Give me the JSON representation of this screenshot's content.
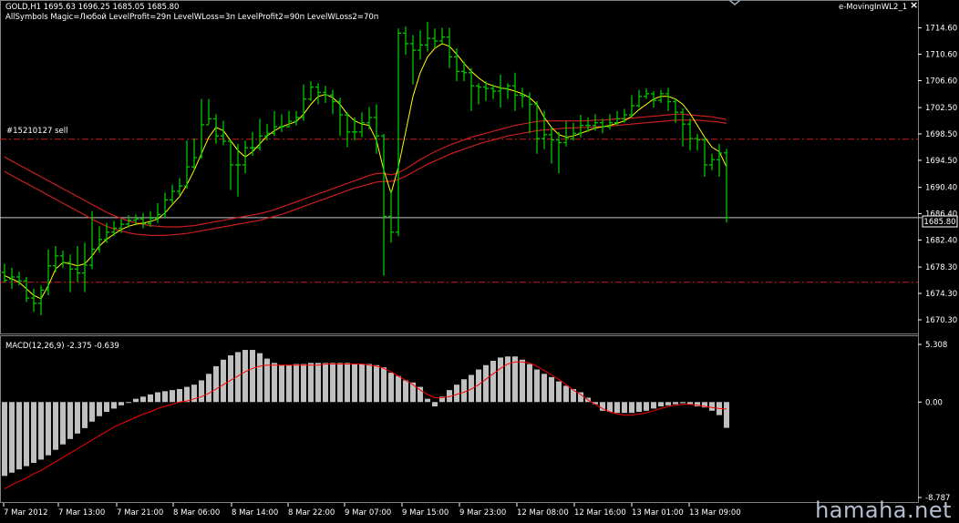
{
  "header": {
    "line1": "GOLD,H1  1695.63 1696.25 1685.05 1685.80",
    "line2": "AllSymbols  Magic=Любой  LevelProfit=29п  LevelWLoss=3п  LevelProfit2=90п  LevelWLoss2=70п",
    "indicator_name": "e-MovingInWL2_1",
    "close_glyph": "×"
  },
  "order_label": "#15210127 sell",
  "price_tag": "1685.80",
  "macd_label": "MACD(12,26,9) -2.375 -0.639",
  "watermark": "hamaha.net",
  "colors": {
    "bg": "#000000",
    "bull": "#00c800",
    "ma_yellow": "#ffff00",
    "ma_red": "#c81e1e",
    "order_line": "#c81e1e",
    "histogram": "#c0c0c0",
    "signal": "#ff0000",
    "grid": "#ffffff"
  },
  "chart_data": [
    {
      "type": "candlestick",
      "title": "GOLD,H1",
      "y_ticks": [
        "1714.60",
        "1710.60",
        "1706.60",
        "1702.50",
        "1698.50",
        "1694.50",
        "1690.40",
        "1686.40",
        "1682.40",
        "1678.30",
        "1674.30",
        "1670.30"
      ],
      "x_ticks": [
        "7 Mar 2012",
        "7 Mar 13:00",
        "7 Mar 21:00",
        "8 Mar 06:00",
        "8 Mar 14:00",
        "8 Mar 22:00",
        "9 Mar 07:00",
        "9 Mar 15:00",
        "9 Mar 23:00",
        "12 Mar 08:00",
        "12 Mar 16:00",
        "13 Mar 01:00",
        "13 Mar 09:00"
      ],
      "ylim": [
        1668.5,
        1716.2
      ],
      "levels": {
        "current_price": 1685.8,
        "order_sell": 1697.7,
        "level_low": 1676.0
      },
      "last_bar": {
        "open": 1695.63,
        "high": 1696.25,
        "low": 1685.05,
        "close": 1685.8
      },
      "bars": [
        [
          1677.5,
          1676.3,
          1678.8,
          1676.0
        ],
        [
          1676.5,
          1676.8,
          1678.2,
          1675.0
        ],
        [
          1676.8,
          1676.2,
          1677.6,
          1675.5
        ],
        [
          1676.2,
          1673.6,
          1676.8,
          1673.0
        ],
        [
          1673.6,
          1672.8,
          1675.0,
          1671.5
        ],
        [
          1672.8,
          1674.8,
          1675.5,
          1671.0
        ],
        [
          1674.8,
          1678.5,
          1681.0,
          1674.0
        ],
        [
          1678.5,
          1680.0,
          1681.5,
          1677.5
        ],
        [
          1680.0,
          1679.0,
          1680.8,
          1678.2
        ],
        [
          1679.0,
          1678.0,
          1680.2,
          1674.5
        ],
        [
          1678.0,
          1677.4,
          1681.5,
          1676.0
        ],
        [
          1677.4,
          1678.6,
          1682.0,
          1674.5
        ],
        [
          1678.6,
          1681.0,
          1686.8,
          1678.0
        ],
        [
          1681.0,
          1682.5,
          1684.5,
          1680.5
        ],
        [
          1682.5,
          1683.6,
          1685.0,
          1682.0
        ],
        [
          1683.6,
          1684.2,
          1685.3,
          1683.0
        ],
        [
          1684.2,
          1684.8,
          1685.6,
          1683.5
        ],
        [
          1684.8,
          1685.4,
          1686.2,
          1684.3
        ],
        [
          1685.4,
          1685.6,
          1686.3,
          1684.8
        ],
        [
          1685.6,
          1684.9,
          1686.5,
          1684.2
        ],
        [
          1684.9,
          1685.7,
          1686.8,
          1684.4
        ],
        [
          1685.7,
          1686.3,
          1688.0,
          1685.0
        ],
        [
          1686.3,
          1688.5,
          1689.6,
          1685.8
        ],
        [
          1688.5,
          1689.8,
          1690.8,
          1688.0
        ],
        [
          1689.8,
          1690.6,
          1691.8,
          1689.2
        ],
        [
          1690.6,
          1693.5,
          1697.5,
          1690.2
        ],
        [
          1693.5,
          1694.9,
          1697.8,
          1693.0
        ],
        [
          1694.9,
          1699.9,
          1703.8,
          1694.8
        ],
        [
          1699.9,
          1700.8,
          1703.8,
          1700.0
        ],
        [
          1700.8,
          1698.2,
          1701.5,
          1697.0
        ],
        [
          1698.2,
          1697.4,
          1700.5,
          1696.8
        ],
        [
          1697.4,
          1693.8,
          1697.5,
          1690.0
        ],
        [
          1693.8,
          1693.8,
          1697.0,
          1689.0
        ],
        [
          1693.8,
          1696.4,
          1697.5,
          1692.5
        ],
        [
          1696.4,
          1696.4,
          1698.8,
          1695.2
        ],
        [
          1696.4,
          1698.2,
          1700.8,
          1696.0
        ],
        [
          1698.2,
          1698.6,
          1700.0,
          1697.5
        ],
        [
          1698.6,
          1699.6,
          1702.0,
          1698.2
        ],
        [
          1699.6,
          1699.6,
          1701.5,
          1698.8
        ],
        [
          1699.6,
          1700.4,
          1702.0,
          1699.5
        ],
        [
          1700.4,
          1701.0,
          1702.0,
          1699.8
        ],
        [
          1701.0,
          1703.8,
          1706.0,
          1700.5
        ],
        [
          1703.8,
          1705.6,
          1706.5,
          1703.5
        ],
        [
          1705.6,
          1704.8,
          1706.2,
          1703.0
        ],
        [
          1704.8,
          1704.4,
          1705.8,
          1703.2
        ],
        [
          1704.4,
          1703.4,
          1705.2,
          1701.5
        ],
        [
          1703.4,
          1701.4,
          1704.0,
          1698.2
        ],
        [
          1701.4,
          1698.8,
          1701.8,
          1696.5
        ],
        [
          1698.8,
          1698.8,
          1701.0,
          1697.5
        ],
        [
          1698.8,
          1700.2,
          1701.8,
          1698.0
        ],
        [
          1700.2,
          1701.0,
          1702.6,
          1699.2
        ],
        [
          1701.0,
          1698.2,
          1703.0,
          1695.5
        ],
        [
          1698.2,
          1686.0,
          1698.5,
          1677.0
        ],
        [
          1686.0,
          1683.6,
          1690.0,
          1682.0
        ],
        [
          1683.6,
          1713.8,
          1714.5,
          1683.0
        ],
        [
          1713.8,
          1712.2,
          1714.8,
          1710.5
        ],
        [
          1712.2,
          1711.2,
          1713.5,
          1706.0
        ],
        [
          1711.2,
          1712.0,
          1714.2,
          1709.8
        ],
        [
          1712.0,
          1713.0,
          1715.5,
          1711.0
        ],
        [
          1713.0,
          1712.6,
          1714.5,
          1711.5
        ],
        [
          1712.6,
          1713.2,
          1714.6,
          1712.2
        ],
        [
          1713.2,
          1710.2,
          1714.6,
          1708.5
        ],
        [
          1710.2,
          1708.0,
          1711.5,
          1706.5
        ],
        [
          1708.0,
          1707.8,
          1709.5,
          1706.5
        ],
        [
          1707.8,
          1705.8,
          1708.5,
          1702.0
        ],
        [
          1705.8,
          1705.6,
          1706.2,
          1703.0
        ],
        [
          1705.6,
          1705.4,
          1706.5,
          1703.5
        ],
        [
          1705.4,
          1705.0,
          1706.0,
          1703.8
        ],
        [
          1705.0,
          1705.4,
          1707.5,
          1702.5
        ],
        [
          1705.4,
          1705.8,
          1706.2,
          1703.8
        ],
        [
          1705.8,
          1704.4,
          1707.8,
          1702.0
        ],
        [
          1704.4,
          1704.2,
          1705.5,
          1702.5
        ],
        [
          1704.2,
          1703.0,
          1704.8,
          1698.6
        ],
        [
          1703.0,
          1697.8,
          1703.5,
          1695.5
        ],
        [
          1697.8,
          1698.4,
          1702.0,
          1696.2
        ],
        [
          1698.4,
          1697.6,
          1699.5,
          1694.0
        ],
        [
          1697.6,
          1697.2,
          1698.8,
          1692.5
        ],
        [
          1697.2,
          1697.8,
          1700.4,
          1696.6
        ],
        [
          1697.8,
          1698.6,
          1700.2,
          1697.5
        ],
        [
          1698.6,
          1699.8,
          1701.4,
          1698.0
        ],
        [
          1699.8,
          1699.8,
          1701.0,
          1698.8
        ],
        [
          1699.8,
          1700.2,
          1701.5,
          1699.0
        ],
        [
          1700.2,
          1699.6,
          1700.8,
          1698.6
        ],
        [
          1699.6,
          1700.2,
          1701.5,
          1699.2
        ],
        [
          1700.2,
          1700.8,
          1702.0,
          1699.8
        ],
        [
          1700.8,
          1701.4,
          1702.3,
          1700.2
        ],
        [
          1701.4,
          1702.8,
          1704.4,
          1701.0
        ],
        [
          1702.8,
          1704.2,
          1705.2,
          1702.5
        ],
        [
          1704.2,
          1704.6,
          1705.4,
          1703.8
        ],
        [
          1704.6,
          1703.6,
          1705.0,
          1702.5
        ],
        [
          1703.6,
          1704.6,
          1705.2,
          1703.2
        ],
        [
          1704.6,
          1703.4,
          1705.5,
          1702.0
        ],
        [
          1703.4,
          1701.8,
          1703.8,
          1700.2
        ],
        [
          1701.8,
          1700.0,
          1702.4,
          1696.6
        ],
        [
          1700.0,
          1697.8,
          1700.8,
          1696.0
        ],
        [
          1697.8,
          1697.6,
          1698.5,
          1696.0
        ],
        [
          1697.6,
          1693.8,
          1698.0,
          1692.0
        ],
        [
          1693.8,
          1694.6,
          1695.5,
          1693.0
        ],
        [
          1694.6,
          1695.6,
          1697.0,
          1692.0
        ],
        [
          1695.63,
          1685.8,
          1696.25,
          1685.05
        ]
      ],
      "ma_yellow": [
        1677.0,
        1676.5,
        1676.0,
        1675.0,
        1674.0,
        1673.5,
        1675.5,
        1678.0,
        1679.0,
        1678.8,
        1678.5,
        1678.8,
        1680.0,
        1681.5,
        1682.5,
        1683.3,
        1684.0,
        1684.5,
        1684.8,
        1685.0,
        1685.2,
        1685.6,
        1686.5,
        1687.8,
        1689.0,
        1690.8,
        1693.0,
        1695.5,
        1698.0,
        1699.5,
        1699.0,
        1697.5,
        1696.0,
        1695.0,
        1695.8,
        1697.0,
        1698.2,
        1699.0,
        1699.6,
        1700.0,
        1700.4,
        1701.5,
        1703.0,
        1704.2,
        1704.5,
        1704.0,
        1703.0,
        1701.5,
        1700.5,
        1700.0,
        1699.8,
        1697.5,
        1693.0,
        1689.5,
        1693.5,
        1698.8,
        1704.2,
        1707.8,
        1710.2,
        1711.5,
        1712.2,
        1711.8,
        1710.6,
        1709.2,
        1708.0,
        1707.0,
        1706.2,
        1705.8,
        1705.5,
        1705.3,
        1705.0,
        1704.6,
        1704.0,
        1703.0,
        1701.0,
        1699.5,
        1698.4,
        1698.0,
        1698.2,
        1698.6,
        1699.0,
        1699.4,
        1699.6,
        1699.8,
        1700.1,
        1700.5,
        1701.2,
        1702.2,
        1703.0,
        1703.8,
        1704.2,
        1704.2,
        1703.8,
        1703.0,
        1701.6,
        1699.8,
        1698.0,
        1696.5,
        1695.8,
        1693.5
      ],
      "ma_red1": [
        1695.0,
        1694.4,
        1693.8,
        1693.2,
        1692.6,
        1692.0,
        1691.4,
        1690.8,
        1690.2,
        1689.6,
        1689.0,
        1688.4,
        1687.8,
        1687.2,
        1686.6,
        1686.1,
        1685.7,
        1685.3,
        1685.0,
        1684.8,
        1684.6,
        1684.5,
        1684.4,
        1684.4,
        1684.4,
        1684.5,
        1684.6,
        1684.8,
        1685.0,
        1685.2,
        1685.4,
        1685.6,
        1685.8,
        1686.0,
        1686.2,
        1686.4,
        1686.7,
        1687.0,
        1687.4,
        1687.8,
        1688.2,
        1688.6,
        1689.0,
        1689.4,
        1689.8,
        1690.2,
        1690.6,
        1691.0,
        1691.4,
        1691.8,
        1692.2,
        1692.5,
        1692.5,
        1692.3,
        1692.6,
        1693.2,
        1693.9,
        1694.6,
        1695.2,
        1695.8,
        1696.3,
        1696.8,
        1697.2,
        1697.6,
        1698.0,
        1698.3,
        1698.6,
        1698.9,
        1699.2,
        1699.5,
        1699.8,
        1700.0,
        1700.2,
        1700.4,
        1700.5,
        1700.5,
        1700.5,
        1700.5,
        1700.5,
        1700.5,
        1700.5,
        1700.6,
        1700.6,
        1700.7,
        1700.8,
        1700.8,
        1700.9,
        1701.0,
        1701.1,
        1701.2,
        1701.3,
        1701.4,
        1701.5,
        1701.5,
        1701.4,
        1701.3,
        1701.2,
        1701.1,
        1700.9,
        1700.7
      ],
      "ma_red2": [
        1692.8,
        1692.2,
        1691.6,
        1691.0,
        1690.4,
        1689.8,
        1689.2,
        1688.6,
        1688.0,
        1687.4,
        1686.8,
        1686.2,
        1685.6,
        1685.0,
        1684.5,
        1684.1,
        1683.8,
        1683.5,
        1683.3,
        1683.2,
        1683.1,
        1683.1,
        1683.1,
        1683.2,
        1683.3,
        1683.4,
        1683.6,
        1683.8,
        1684.0,
        1684.2,
        1684.4,
        1684.6,
        1684.8,
        1685.0,
        1685.2,
        1685.4,
        1685.7,
        1686.0,
        1686.3,
        1686.7,
        1687.1,
        1687.5,
        1687.9,
        1688.3,
        1688.7,
        1689.1,
        1689.5,
        1689.9,
        1690.3,
        1690.6,
        1690.9,
        1691.2,
        1691.3,
        1691.3,
        1691.6,
        1692.1,
        1692.7,
        1693.3,
        1693.9,
        1694.4,
        1694.9,
        1695.4,
        1695.8,
        1696.2,
        1696.6,
        1697.0,
        1697.3,
        1697.6,
        1697.9,
        1698.2,
        1698.4,
        1698.6,
        1698.8,
        1699.0,
        1699.1,
        1699.2,
        1699.3,
        1699.4,
        1699.4,
        1699.5,
        1699.5,
        1699.6,
        1699.6,
        1699.7,
        1699.8,
        1699.9,
        1700.0,
        1700.1,
        1700.2,
        1700.3,
        1700.4,
        1700.5,
        1700.6,
        1700.6,
        1700.6,
        1700.6,
        1700.5,
        1700.4,
        1700.3,
        1700.1
      ]
    },
    {
      "type": "bar",
      "title": "MACD(12,26,9)",
      "values_label": "-2.375 -0.639",
      "y_ticks": [
        "5.308",
        "0.00",
        "-8.787"
      ],
      "ylim": [
        -8.787,
        5.308
      ],
      "histogram": [
        -6.8,
        -6.5,
        -6.2,
        -5.9,
        -5.6,
        -5.3,
        -4.9,
        -4.4,
        -3.9,
        -3.4,
        -2.9,
        -2.4,
        -1.8,
        -1.3,
        -0.9,
        -0.6,
        -0.3,
        0.0,
        0.3,
        0.5,
        0.7,
        0.9,
        1.0,
        1.1,
        1.2,
        1.4,
        1.6,
        2.0,
        2.6,
        3.3,
        3.9,
        4.3,
        4.6,
        4.8,
        4.8,
        4.5,
        4.0,
        3.6,
        3.4,
        3.4,
        3.5,
        3.5,
        3.6,
        3.6,
        3.6,
        3.6,
        3.6,
        3.6,
        3.5,
        3.5,
        3.5,
        3.4,
        3.2,
        2.7,
        2.4,
        2.0,
        1.8,
        1.4,
        0.3,
        -0.4,
        0.5,
        1.1,
        1.6,
        2.1,
        2.5,
        3.0,
        3.4,
        3.8,
        4.1,
        4.2,
        4.2,
        3.9,
        3.5,
        3.0,
        2.6,
        2.3,
        1.9,
        1.5,
        1.2,
        0.9,
        0.4,
        -0.2,
        -0.8,
        -0.9,
        -1.0,
        -1.0,
        -1.0,
        -0.9,
        -0.8,
        -0.6,
        -0.4,
        -0.3,
        -0.2,
        -0.1,
        -0.2,
        -0.4,
        -0.5,
        -0.8,
        -1.2,
        -2.375
      ],
      "signal": [
        -8.0,
        -7.6,
        -7.3,
        -7.0,
        -6.6,
        -6.3,
        -5.9,
        -5.5,
        -5.1,
        -4.7,
        -4.3,
        -3.9,
        -3.5,
        -3.1,
        -2.7,
        -2.3,
        -2.0,
        -1.7,
        -1.4,
        -1.1,
        -0.9,
        -0.6,
        -0.4,
        -0.2,
        0.0,
        0.1,
        0.3,
        0.5,
        0.8,
        1.2,
        1.6,
        2.0,
        2.4,
        2.8,
        3.1,
        3.3,
        3.4,
        3.4,
        3.4,
        3.4,
        3.4,
        3.4,
        3.4,
        3.4,
        3.5,
        3.5,
        3.5,
        3.5,
        3.5,
        3.5,
        3.4,
        3.3,
        3.1,
        2.8,
        2.4,
        2.0,
        1.6,
        1.1,
        0.7,
        0.4,
        0.4,
        0.5,
        0.7,
        0.9,
        1.2,
        1.6,
        2.1,
        2.6,
        3.1,
        3.5,
        3.7,
        3.7,
        3.6,
        3.3,
        2.9,
        2.5,
        2.1,
        1.6,
        1.1,
        0.7,
        0.2,
        -0.2,
        -0.6,
        -0.9,
        -1.1,
        -1.2,
        -1.2,
        -1.1,
        -1.0,
        -0.8,
        -0.6,
        -0.4,
        -0.3,
        -0.2,
        -0.2,
        -0.3,
        -0.4,
        -0.5,
        -0.6,
        -0.639
      ]
    }
  ]
}
